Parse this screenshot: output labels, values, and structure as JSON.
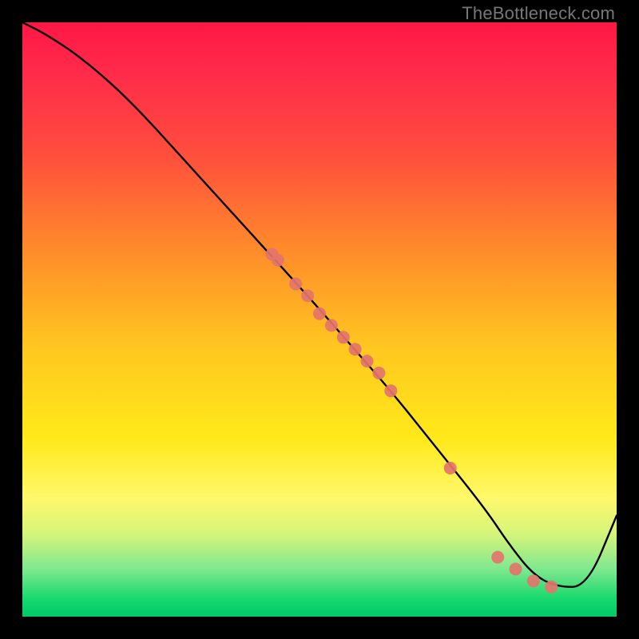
{
  "watermark": "TheBottleneck.com",
  "chart_data": {
    "type": "line",
    "title": "",
    "xlabel": "",
    "ylabel": "",
    "xlim": [
      0,
      100
    ],
    "ylim": [
      0,
      100
    ],
    "grid": false,
    "series": [
      {
        "name": "curve",
        "x": [
          0,
          4,
          10,
          18,
          28,
          38,
          48,
          55,
          62,
          70,
          78,
          82,
          86,
          90,
          95,
          100
        ],
        "y": [
          100,
          98,
          94,
          87,
          76,
          65,
          54,
          46,
          38,
          28,
          18,
          12,
          7,
          5,
          5,
          17
        ]
      }
    ],
    "points": {
      "name": "dots",
      "x": [
        42,
        43,
        46,
        48,
        50,
        52,
        54,
        56,
        58,
        60,
        62,
        72,
        80,
        83,
        86,
        89
      ],
      "y": [
        61,
        60,
        56,
        54,
        51,
        49,
        47,
        45,
        43,
        41,
        38,
        25,
        10,
        8,
        6,
        5
      ]
    }
  }
}
